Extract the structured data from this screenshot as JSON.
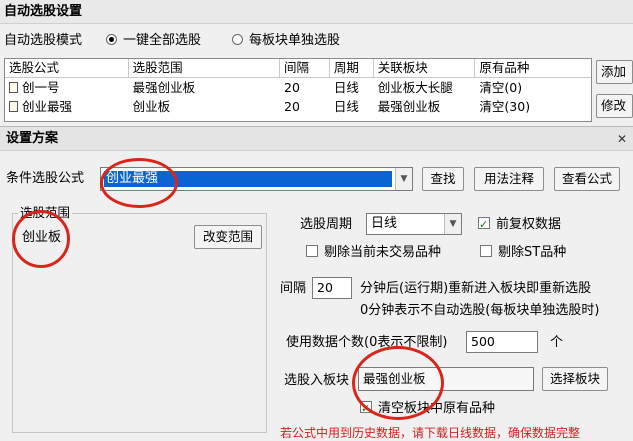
{
  "window": {
    "title": "自动选股设置"
  },
  "mode": {
    "label": "自动选股模式",
    "options": [
      {
        "label": "一键全部选股",
        "selected": true
      },
      {
        "label": "每板块单独选股",
        "selected": false
      }
    ]
  },
  "formula_table": {
    "columns": [
      "选股公式",
      "选股范围",
      "间隔",
      "周期",
      "关联板块",
      "原有品种"
    ],
    "rows": [
      [
        "创一号",
        "最强创业板",
        "20",
        "日线",
        "创业板大长腿",
        "清空(0)"
      ],
      [
        "创业最强",
        "创业板",
        "20",
        "日线",
        "最强创业板",
        "清空(30)"
      ]
    ]
  },
  "side_buttons": {
    "add": "添加",
    "modify": "修改"
  },
  "dialog": {
    "title": "设置方案",
    "formula_label": "条件选股公式",
    "formula_value": "创业最强",
    "find_button": "查找",
    "usage_button": "用法注释",
    "view_button": "查看公式",
    "range_group_label": "选股范围",
    "range_value": "创业板",
    "change_range_button": "改变范围",
    "period_label": "选股周期",
    "period_value": "日线",
    "prior_adj_label": "前复权数据",
    "prior_adj_checked": true,
    "exclude_no_trade_label": "剔除当前未交易品种",
    "exclude_st_label": "剔除ST品种",
    "interval_label": "间隔",
    "interval_value": "20",
    "interval_desc_1": "分钟后(运行期)重新进入板块即重新选股",
    "interval_desc_2": "0分钟表示不自动选股(每板块单独选股时)",
    "data_count_label": "使用数据个数(0表示不限制)",
    "data_count_value": "500",
    "data_count_unit": "个",
    "target_block_label": "选股入板块",
    "target_block_value": "最强创业板",
    "choose_block_button": "选择板块",
    "clear_block_label": "清空板块中原有品种",
    "clear_block_checked": true,
    "warning": "若公式中用到历史数据，请下载日线数据，确保数据完整"
  },
  "colors": {
    "highlight": "#0a64d2",
    "annotation_red": "#d9261c",
    "warning_red": "#d42020"
  }
}
